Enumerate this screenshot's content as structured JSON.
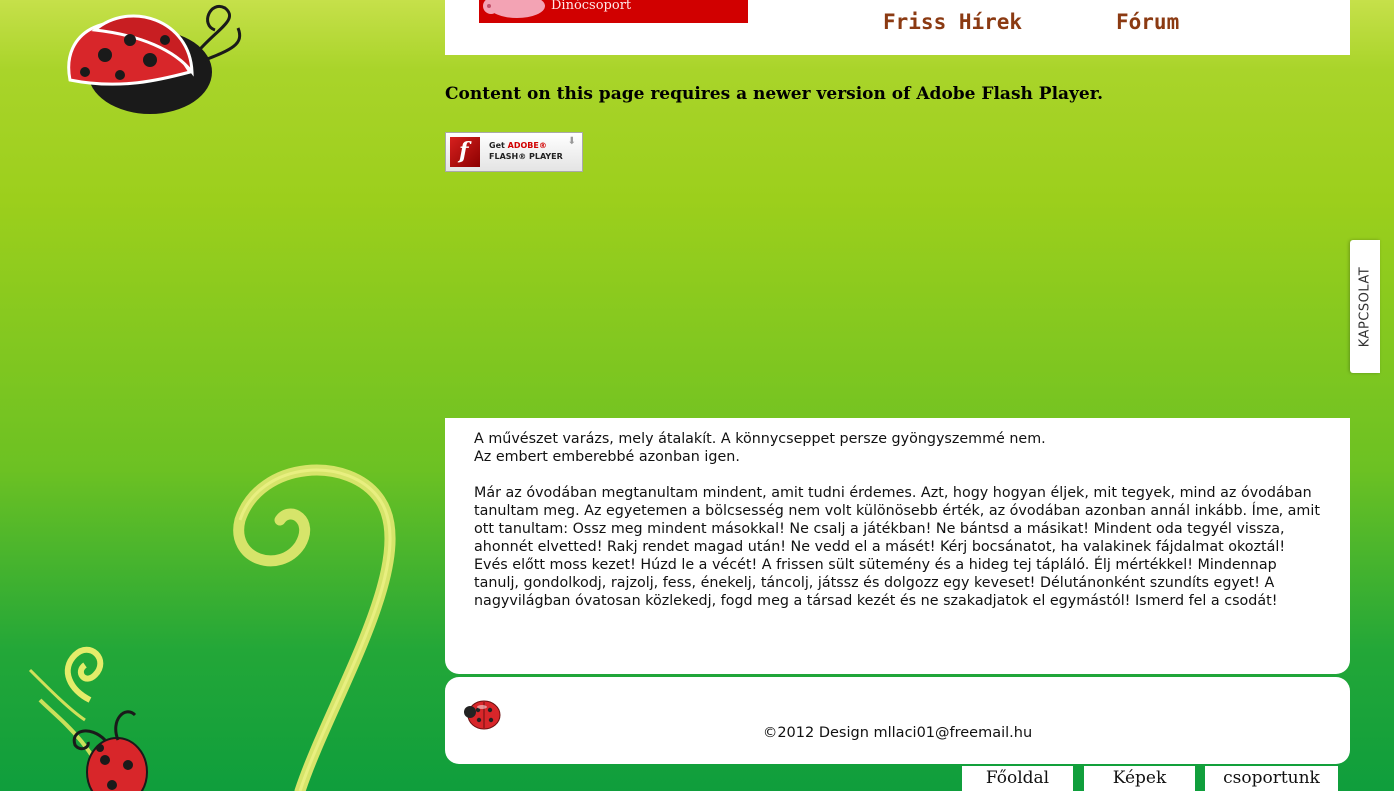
{
  "header": {
    "logo_text": "Dinócsoport",
    "nav": [
      {
        "label": "Friss Hírek"
      },
      {
        "label": "Fórum"
      }
    ]
  },
  "flash": {
    "message": "Content on this page requires a newer version of Adobe Flash Player.",
    "badge_get": "Get",
    "badge_adobe": "ADOBE®",
    "badge_product": "FLASH® PLAYER",
    "badge_icon": "flash-player-icon"
  },
  "side_tab": {
    "label": "KAPCSOLAT"
  },
  "content": {
    "quote_line1": "A művészet varázs, mely átalakít. A könnycseppet persze gyöngyszemmé nem.",
    "quote_line2": "Az embert emberebbé azonban igen.",
    "paragraph": "Már az óvodában megtanultam mindent, amit tudni érdemes. Azt, hogy hogyan éljek, mit tegyek, mind az óvodában tanultam meg. Az egyetemen a bölcsesség nem volt különösebb érték, az óvodában azonban annál inkább. Íme, amit ott tanultam: Ossz meg mindent másokkal! Ne csalj a játékban! Ne bántsd a másikat! Mindent oda tegyél vissza, ahonnét elvetted! Rakj rendet magad után! Ne vedd el a másét! Kérj bocsánatot, ha valakinek fájdalmat okoztál! Evés előtt moss kezet! Húzd le a vécét! A frissen sült sütemény és a hideg tej tápláló. Élj mértékkel! Mindennap tanulj, gondolkodj, rajzolj, fess, énekelj, táncolj, játssz és dolgozz egy keveset! Délutánonként szundíts egyet! A nagyvilágban óvatosan közlekedj, fogd meg a társad kezét és ne szakadjatok el egymástól! Ismerd fel a csodát!"
  },
  "footer": {
    "copyright": "©2012 Design mllaci01@freemail.hu",
    "icon": "ladybug-icon"
  },
  "bottom_nav": [
    {
      "label": "Főoldal"
    },
    {
      "label": "Képek"
    },
    {
      "label": "csoportunk"
    }
  ],
  "colors": {
    "nav_link": "#8b3a12",
    "logo_banner": "#d10000",
    "ladybug_red": "#d8262a"
  }
}
